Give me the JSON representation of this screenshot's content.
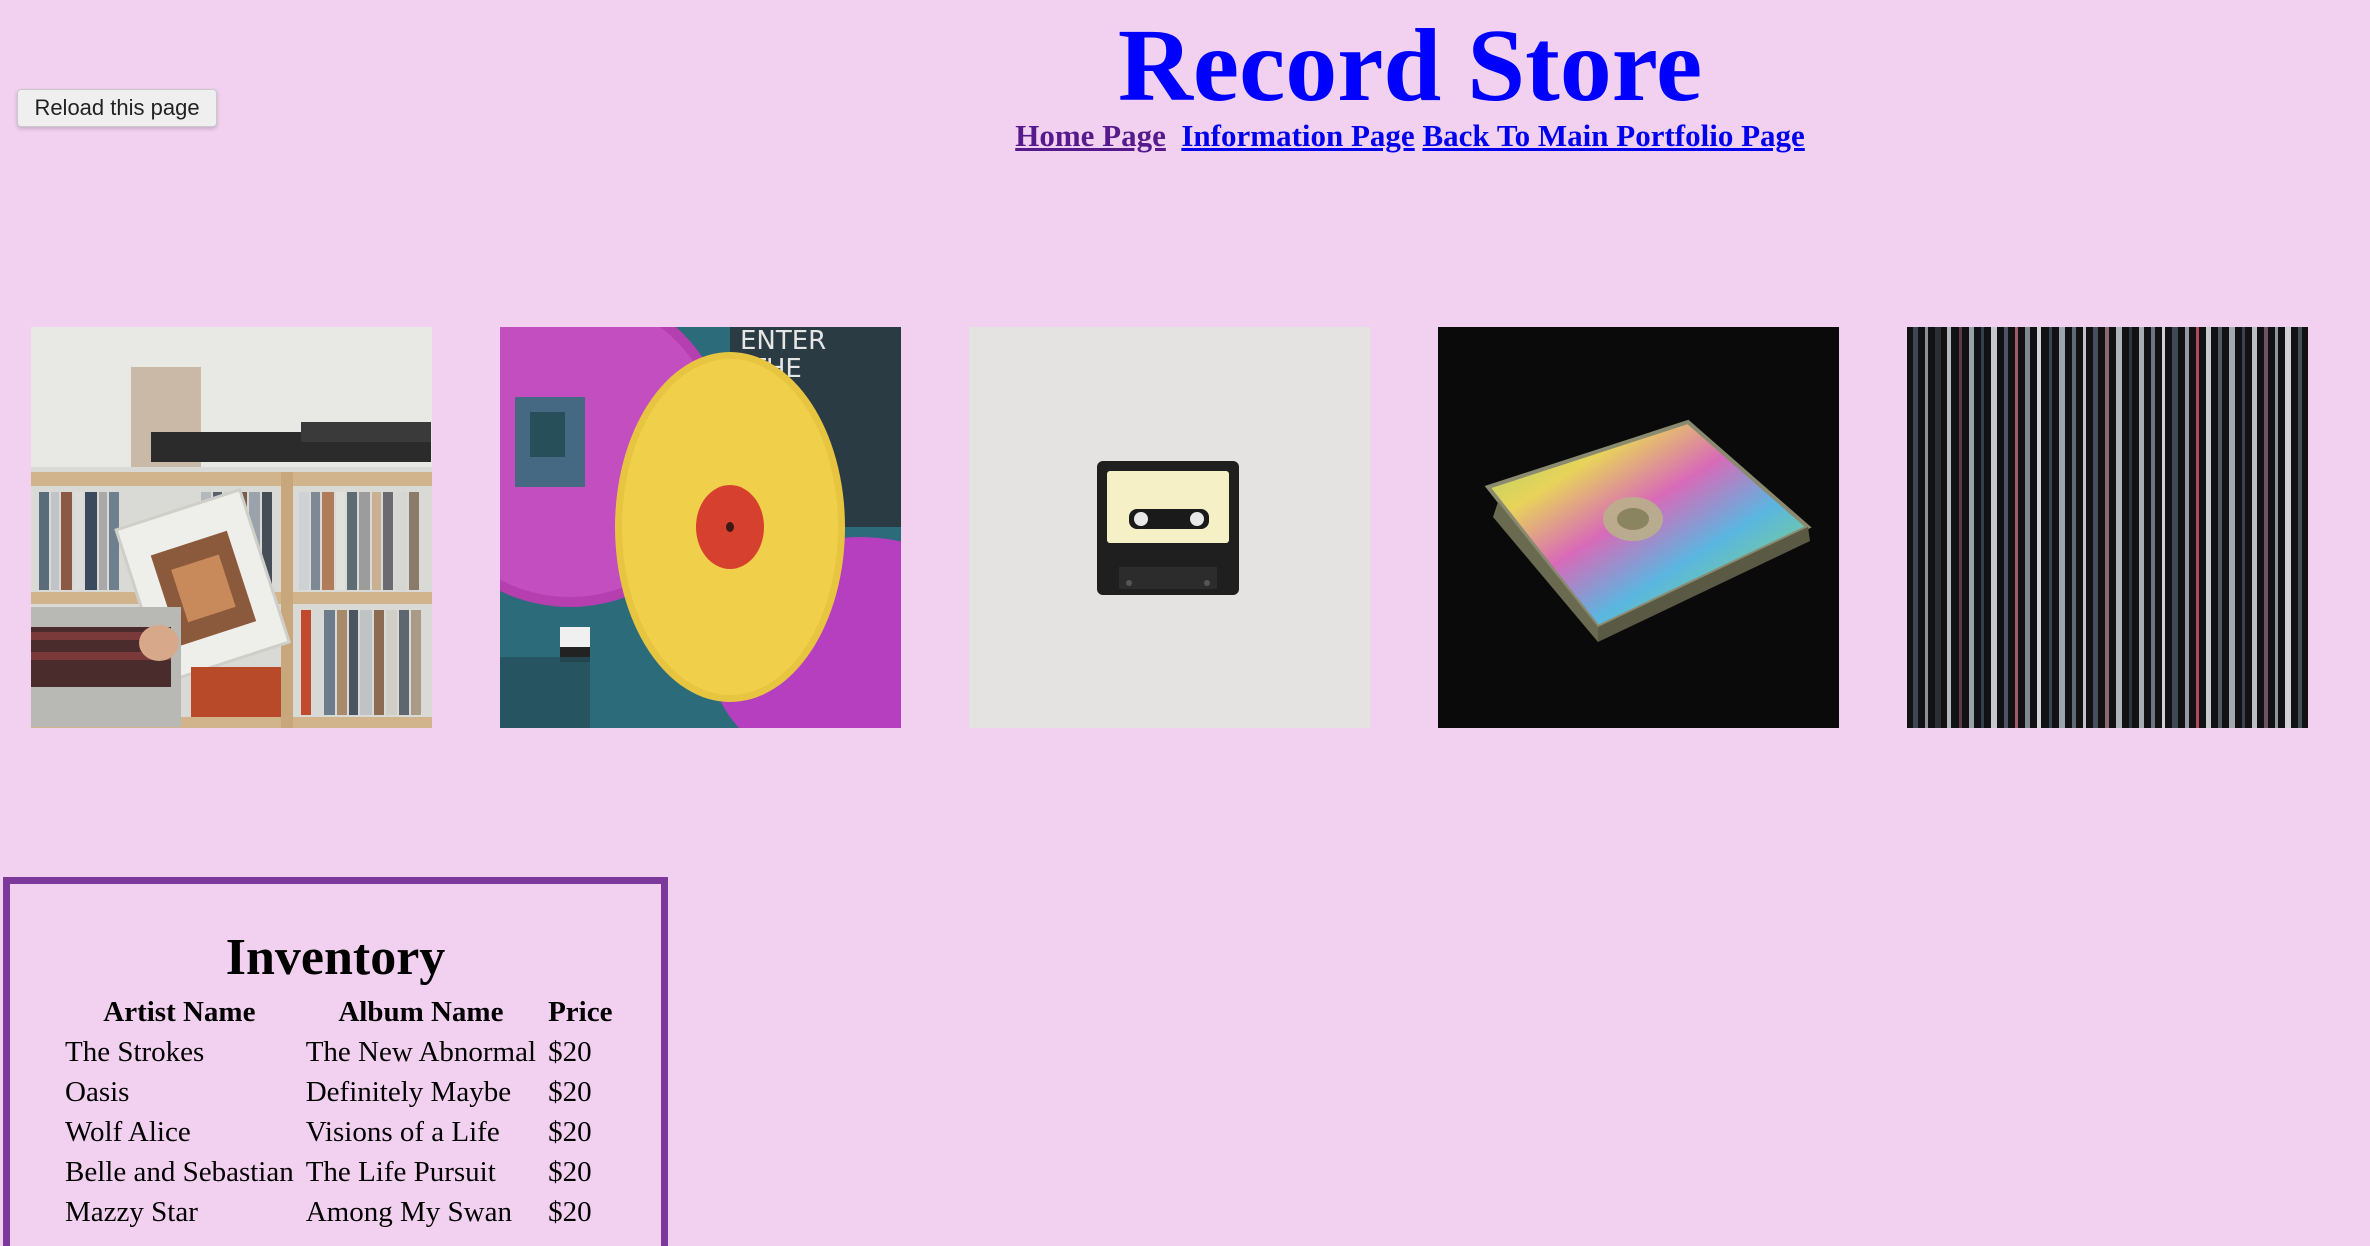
{
  "reload_button": {
    "label": "Reload this page"
  },
  "header": {
    "title": "Record Store",
    "nav": {
      "home": "Home Page",
      "info": "Information Page",
      "portfolio": "Back To Main Portfolio Page"
    }
  },
  "gallery": {
    "images": [
      {
        "name": "record-shelf-photo"
      },
      {
        "name": "yellow-vinyl-photo"
      },
      {
        "name": "cassette-tape-photo"
      },
      {
        "name": "cd-case-photo"
      },
      {
        "name": "record-spines-photo"
      }
    ]
  },
  "inventory": {
    "title": "Inventory",
    "headers": [
      "Artist Name",
      "Album Name",
      "Price"
    ],
    "rows": [
      [
        "The Strokes",
        "The New Abnormal",
        "$20"
      ],
      [
        "Oasis",
        "Definitely Maybe",
        "$20"
      ],
      [
        "Wolf Alice",
        "Visions of a Life",
        "$20"
      ],
      [
        "Belle and Sebastian",
        "The Life Pursuit",
        "$20"
      ],
      [
        "Mazzy Star",
        "Among My Swan",
        "$20"
      ]
    ]
  }
}
